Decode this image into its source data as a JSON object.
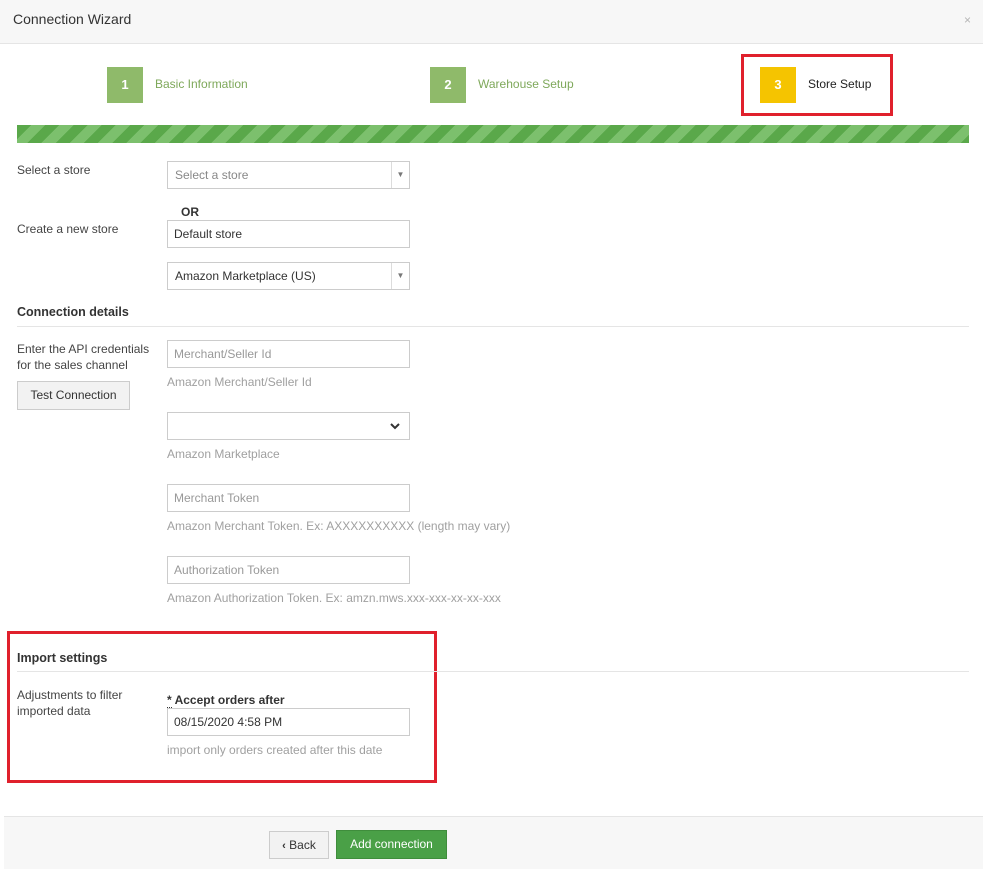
{
  "window": {
    "title": "Connection Wizard",
    "close_glyph": "×"
  },
  "steps": [
    {
      "number": "1",
      "label": "Basic Information",
      "state": "done"
    },
    {
      "number": "2",
      "label": "Warehouse Setup",
      "state": "done"
    },
    {
      "number": "3",
      "label": "Store Setup",
      "state": "active"
    }
  ],
  "store": {
    "select_label": "Select a store",
    "select_placeholder": "Select a store",
    "or_text": "OR",
    "create_label": "Create a new store",
    "new_store_value": "Default store",
    "channel_value": "Amazon Marketplace (US)"
  },
  "connection": {
    "section_title": "Connection details",
    "description": "Enter the API credentials for the sales channel",
    "test_button": "Test Connection",
    "merchant_id": {
      "placeholder": "Merchant/Seller Id",
      "hint": "Amazon Merchant/Seller Id"
    },
    "marketplace": {
      "value": "",
      "hint": "Amazon Marketplace"
    },
    "merchant_token": {
      "placeholder": "Merchant Token",
      "hint": "Amazon Merchant Token. Ex: AXXXXXXXXXX (length may vary)"
    },
    "auth_token": {
      "placeholder": "Authorization Token",
      "hint": "Amazon Authorization Token. Ex: amzn.mws.xxx-xxx-xx-xx-xxx"
    }
  },
  "import": {
    "section_title": "Import settings",
    "description": "Adjustments to filter imported data",
    "required_mark": "*",
    "field_label": "Accept orders after",
    "field_value": "08/15/2020 4:58 PM",
    "hint": "import only orders created after this date"
  },
  "footer": {
    "back_label": "Back",
    "back_icon": "chevron-left-icon",
    "add_label": "Add connection"
  },
  "colors": {
    "step_done": "#8fba6a",
    "step_active": "#f5c400",
    "highlight": "#e0202c",
    "primary": "#4aa047"
  }
}
